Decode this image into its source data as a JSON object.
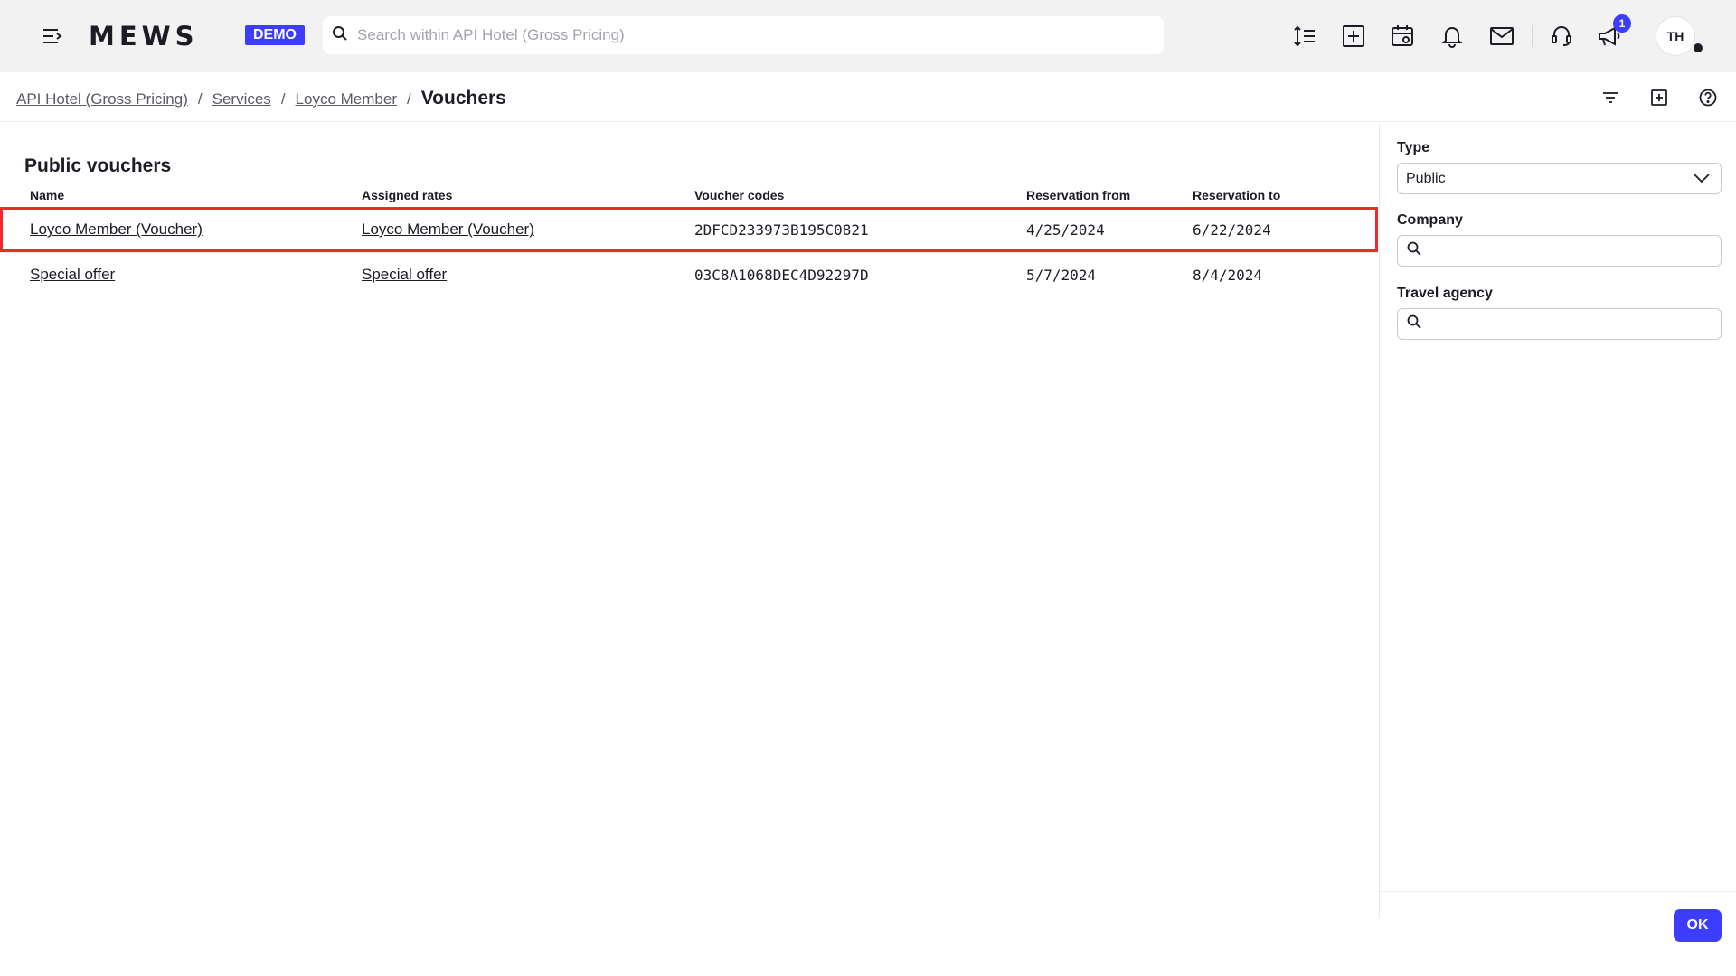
{
  "app": {
    "logo": "MEWS",
    "badge": "DEMO"
  },
  "search": {
    "placeholder": "Search within API Hotel (Gross Pricing)",
    "value": ""
  },
  "topbar_icons": [
    "menu-collapse-icon",
    "search-icon",
    "line-spacing-icon",
    "add-square-icon",
    "calendar-icon",
    "bell-icon",
    "mail-icon",
    "support-icon",
    "megaphone-icon"
  ],
  "notifications": {
    "count": "1"
  },
  "user": {
    "initials": "TH"
  },
  "breadcrumb": {
    "items": [
      "API Hotel (Gross Pricing)",
      "Services",
      "Loyco Member"
    ],
    "separator": "/",
    "current": "Vouchers"
  },
  "toolbar_icons": [
    "filter-icon",
    "add-square-icon",
    "help-icon"
  ],
  "main": {
    "section_title": "Public vouchers",
    "columns": [
      "Name",
      "Assigned rates",
      "Voucher codes",
      "Reservation from",
      "Reservation to"
    ],
    "rows": [
      {
        "name": "Loyco Member (Voucher)",
        "rate": "Loyco Member (Voucher)",
        "code": "2DFCD233973B195C0821",
        "from": "4/25/2024",
        "to": "6/22/2024"
      },
      {
        "name": "Special offer",
        "rate": "Special offer",
        "code": "03C8A1068DEC4D92297D",
        "from": "5/7/2024",
        "to": "8/4/2024"
      }
    ]
  },
  "filters": {
    "type": {
      "label": "Type",
      "value": "Public"
    },
    "company": {
      "label": "Company",
      "value": ""
    },
    "travel_agency": {
      "label": "Travel agency",
      "value": ""
    },
    "ok_label": "OK"
  },
  "colors": {
    "accent": "#3d3dff",
    "highlight": "#ee2a2a",
    "topbar_bg": "#f2f2f3"
  }
}
